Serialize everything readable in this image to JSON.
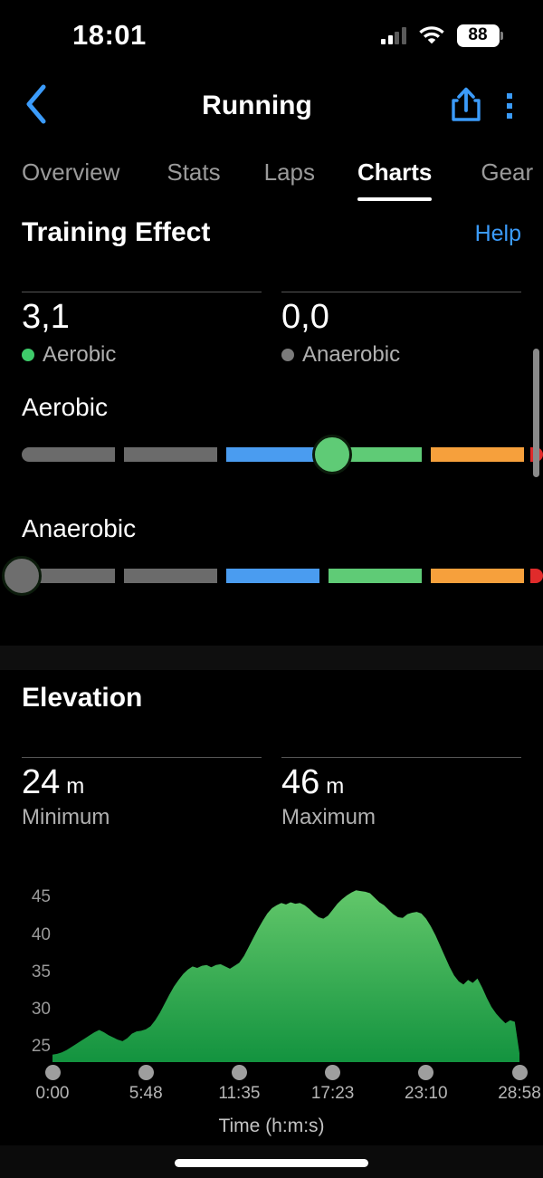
{
  "status_bar": {
    "time": "18:01",
    "battery_level": "88",
    "signal_bars_filled": 2,
    "signal_bars_total": 4,
    "wifi_icon": "wifi-icon"
  },
  "nav": {
    "title": "Running",
    "back_icon": "chevron-left-icon",
    "share_icon": "share-icon",
    "overflow_icon": "more-vertical-icon",
    "accent": "#3b9bfa"
  },
  "tabs": {
    "items": [
      {
        "label": "Overview",
        "active": false
      },
      {
        "label": "Stats",
        "active": false
      },
      {
        "label": "Laps",
        "active": false
      },
      {
        "label": "Charts",
        "active": true
      },
      {
        "label": "Gear",
        "active": false
      }
    ]
  },
  "training_effect": {
    "title": "Training Effect",
    "help_label": "Help",
    "stats": [
      {
        "value": "3,1",
        "label": "Aerobic",
        "dot_color": "#3ecb6a"
      },
      {
        "value": "0,0",
        "label": "Anaerobic",
        "dot_color": "#7a7a7a"
      }
    ],
    "sliders": [
      {
        "name": "Aerobic",
        "marker_color": "#5fcb76",
        "marker_position_pct": 59.5,
        "segments": [
          {
            "color": "#6b6b6b",
            "start_pct": 0,
            "width_pct": 17.9,
            "round": "left"
          },
          {
            "color": "#6b6b6b",
            "start_pct": 19.6,
            "width_pct": 17.9,
            "round": "none"
          },
          {
            "color": "#4a9cf0",
            "start_pct": 39.2,
            "width_pct": 17.9,
            "round": "none"
          },
          {
            "color": "#5fcb76",
            "start_pct": 58.8,
            "width_pct": 17.9,
            "round": "none"
          },
          {
            "color": "#f6a03c",
            "start_pct": 78.5,
            "width_pct": 17.9,
            "round": "none"
          },
          {
            "color": "#e02b2b",
            "start_pct": 97.5,
            "width_pct": 2.5,
            "round": "right"
          }
        ]
      },
      {
        "name": "Anaerobic",
        "marker_color": "#6e6e6e",
        "marker_position_pct": 0,
        "segments": [
          {
            "color": "#6b6b6b",
            "start_pct": 0,
            "width_pct": 17.9,
            "round": "left"
          },
          {
            "color": "#6b6b6b",
            "start_pct": 19.6,
            "width_pct": 17.9,
            "round": "none"
          },
          {
            "color": "#4a9cf0",
            "start_pct": 39.2,
            "width_pct": 17.9,
            "round": "none"
          },
          {
            "color": "#5fcb76",
            "start_pct": 58.8,
            "width_pct": 17.9,
            "round": "none"
          },
          {
            "color": "#f6a03c",
            "start_pct": 78.5,
            "width_pct": 17.9,
            "round": "none"
          },
          {
            "color": "#e02b2b",
            "start_pct": 97.5,
            "width_pct": 2.5,
            "round": "right"
          }
        ]
      }
    ]
  },
  "elevation": {
    "title": "Elevation",
    "stats": [
      {
        "value": "24",
        "unit": "m",
        "label": "Minimum"
      },
      {
        "value": "46",
        "unit": "m",
        "label": "Maximum"
      }
    ]
  },
  "chart_data": {
    "type": "area",
    "title": "Elevation",
    "xlabel": "Time (h:m:s)",
    "ylabel": "",
    "unit": "m",
    "fill_color_top": "#62c76a",
    "fill_color_bottom": "#13933f",
    "grid": false,
    "ylim": [
      23,
      47
    ],
    "yticks": [
      25,
      30,
      35,
      40,
      45
    ],
    "xticks": [
      "0:00",
      "5:48",
      "11:35",
      "17:23",
      "23:10",
      "28:58"
    ],
    "minimum": 24,
    "maximum": 46,
    "x": [
      0,
      1,
      2,
      3,
      4,
      5,
      6,
      7,
      8,
      9,
      10,
      11,
      12,
      13,
      14,
      15,
      16,
      17,
      18,
      19,
      20,
      21,
      22,
      23,
      24,
      25,
      26,
      27,
      28,
      29,
      30,
      31,
      32,
      33,
      34,
      35,
      36,
      37,
      38,
      39,
      40,
      41,
      42,
      43,
      44,
      45,
      46,
      47,
      48,
      49,
      50,
      51,
      52,
      53,
      54,
      55,
      56,
      57,
      58,
      59,
      60,
      61,
      62,
      63,
      64,
      65,
      66,
      67,
      68,
      69,
      70,
      71,
      72,
      73,
      74,
      75,
      76,
      77,
      78,
      79,
      80,
      81,
      82,
      83,
      84,
      85,
      86,
      87,
      88,
      89,
      90,
      91,
      92,
      93,
      94,
      95,
      96,
      97,
      98,
      99,
      100
    ],
    "values": [
      24.0,
      24.1,
      24.3,
      24.6,
      25.0,
      25.4,
      25.8,
      26.2,
      26.6,
      27.0,
      27.3,
      27.0,
      26.6,
      26.3,
      26.0,
      25.8,
      26.2,
      26.8,
      27.1,
      27.2,
      27.4,
      27.8,
      28.6,
      29.6,
      30.8,
      32.0,
      33.1,
      34.0,
      34.8,
      35.4,
      35.8,
      35.6,
      35.9,
      36.0,
      35.7,
      36.0,
      36.1,
      35.8,
      35.5,
      35.9,
      36.3,
      37.2,
      38.4,
      39.6,
      40.8,
      41.9,
      42.9,
      43.6,
      44.0,
      44.3,
      44.1,
      44.4,
      44.2,
      44.3,
      44.0,
      43.5,
      42.9,
      42.4,
      42.2,
      42.6,
      43.4,
      44.2,
      44.8,
      45.3,
      45.7,
      46.0,
      45.9,
      45.8,
      45.6,
      45.0,
      44.4,
      44.0,
      43.4,
      42.8,
      42.4,
      42.3,
      42.8,
      43.0,
      43.1,
      42.9,
      42.2,
      41.2,
      40.0,
      38.6,
      37.2,
      35.8,
      34.6,
      33.8,
      33.4,
      34.0,
      33.6,
      34.2,
      33.0,
      31.6,
      30.4,
      29.5,
      28.8,
      28.2,
      28.6,
      28.4,
      24.2
    ]
  },
  "home_indicator": "home-indicator"
}
